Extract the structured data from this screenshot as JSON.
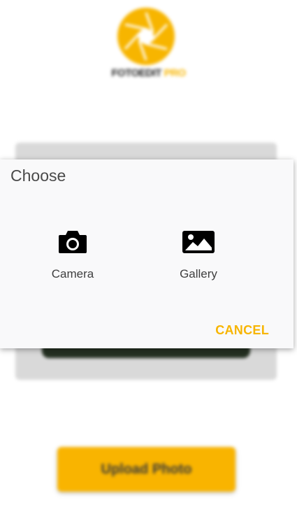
{
  "app": {
    "brand_name_primary": "FOTOEDIT",
    "brand_name_accent": "PRO",
    "accent_color": "#f7b500",
    "logo_icon": "camera-aperture-logo"
  },
  "main": {
    "upload_button_label": "Upload Photo"
  },
  "dialog": {
    "title": "Choose",
    "options": [
      {
        "label": "Camera",
        "icon": "camera-icon"
      },
      {
        "label": "Gallery",
        "icon": "image-icon"
      }
    ],
    "cancel_label": "CANCEL"
  }
}
